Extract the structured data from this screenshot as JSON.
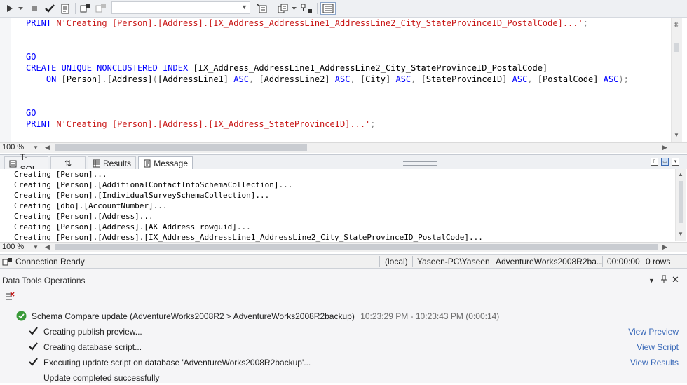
{
  "toolbar": {
    "buttons": [
      {
        "icon": "play-icon"
      },
      {
        "icon": "dropdown-arrow-icon"
      },
      {
        "icon": "stop-icon"
      },
      {
        "icon": "checkmark-icon"
      },
      {
        "icon": "document-icon"
      },
      {
        "icon": "connect-icon"
      },
      {
        "icon": "disconnect-icon"
      },
      {
        "icon": "properties-icon"
      },
      {
        "icon": "new-query-icon"
      },
      {
        "icon": "schema-icon"
      },
      {
        "icon": "results-pane-icon"
      }
    ],
    "database_combo_value": ""
  },
  "editor": {
    "lines": [
      [
        {
          "t": "PRINT ",
          "c": "kw"
        },
        {
          "t": "N'Creating [Person].[Address].[IX_Address_AddressLine1_AddressLine2_City_StateProvinceID_PostalCode]...'",
          "c": "str"
        },
        {
          "t": ";",
          "c": "gray"
        }
      ],
      [],
      [],
      [
        {
          "t": "GO",
          "c": "kw"
        }
      ],
      [
        {
          "t": "CREATE UNIQUE NONCLUSTERED INDEX ",
          "c": "kw"
        },
        {
          "t": "[IX_Address_AddressLine1_AddressLine2_City_StateProvinceID_PostalCode]",
          "c": "txt"
        }
      ],
      [
        {
          "t": "    ON ",
          "c": "kw"
        },
        {
          "t": "[Person]",
          "c": "txt"
        },
        {
          "t": ".",
          "c": "gray"
        },
        {
          "t": "[Address]",
          "c": "txt"
        },
        {
          "t": "(",
          "c": "gray"
        },
        {
          "t": "[AddressLine1] ",
          "c": "txt"
        },
        {
          "t": "ASC",
          "c": "kw"
        },
        {
          "t": ", ",
          "c": "gray"
        },
        {
          "t": "[AddressLine2] ",
          "c": "txt"
        },
        {
          "t": "ASC",
          "c": "kw"
        },
        {
          "t": ", ",
          "c": "gray"
        },
        {
          "t": "[City] ",
          "c": "txt"
        },
        {
          "t": "ASC",
          "c": "kw"
        },
        {
          "t": ", ",
          "c": "gray"
        },
        {
          "t": "[StateProvinceID] ",
          "c": "txt"
        },
        {
          "t": "ASC",
          "c": "kw"
        },
        {
          "t": ", ",
          "c": "gray"
        },
        {
          "t": "[PostalCode] ",
          "c": "txt"
        },
        {
          "t": "ASC",
          "c": "kw"
        },
        {
          "t": ");",
          "c": "gray"
        }
      ],
      [],
      [],
      [
        {
          "t": "GO",
          "c": "kw"
        }
      ],
      [
        {
          "t": "PRINT ",
          "c": "kw"
        },
        {
          "t": "N'Creating [Person].[Address].[IX_Address_StateProvinceID]...'",
          "c": "str"
        },
        {
          "t": ";",
          "c": "gray"
        }
      ]
    ],
    "zoom": "100 %"
  },
  "results_tabs": [
    {
      "label": "T-SQL",
      "icon": "tsql-icon"
    },
    {
      "label": "",
      "icon": "sort-icon"
    },
    {
      "label": "Results",
      "icon": "grid-icon"
    },
    {
      "label": "Message",
      "icon": "message-icon"
    }
  ],
  "messages": {
    "lines": [
      "Creating [Person]...",
      "Creating [Person].[AdditionalContactInfoSchemaCollection]...",
      "Creating [Person].[IndividualSurveySchemaCollection]...",
      "Creating [dbo].[AccountNumber]...",
      "Creating [Person].[Address]...",
      "Creating [Person].[Address].[AK_Address_rowguid]...",
      "Creating [Person].[Address].[IX_Address_AddressLine1_AddressLine2_City_StateProvinceID_PostalCode]..."
    ],
    "zoom": "100 %"
  },
  "statusbar": {
    "connection": "Connection Ready",
    "server": "(local)",
    "user": "Yaseen-PC\\Yaseen",
    "database": "AdventureWorks2008R2ba...",
    "elapsed": "00:00:00",
    "rows": "0 rows"
  },
  "data_tools": {
    "title": "Data Tools Operations",
    "operation": {
      "title": "Schema Compare update (AdventureWorks2008R2 > AdventureWorks2008R2backup)",
      "time": "10:23:29 PM - 10:23:43 PM (0:00:14)",
      "status_color": "#3a9a3a"
    },
    "steps": [
      {
        "label": "Creating publish preview...",
        "link": "View Preview",
        "done": true
      },
      {
        "label": "Creating database script...",
        "link": "View Script",
        "done": true
      },
      {
        "label": "Executing update script on database 'AdventureWorks2008R2backup'...",
        "link": "View Results",
        "done": true
      },
      {
        "label": "Update completed successfully",
        "link": "",
        "done": false
      }
    ]
  }
}
